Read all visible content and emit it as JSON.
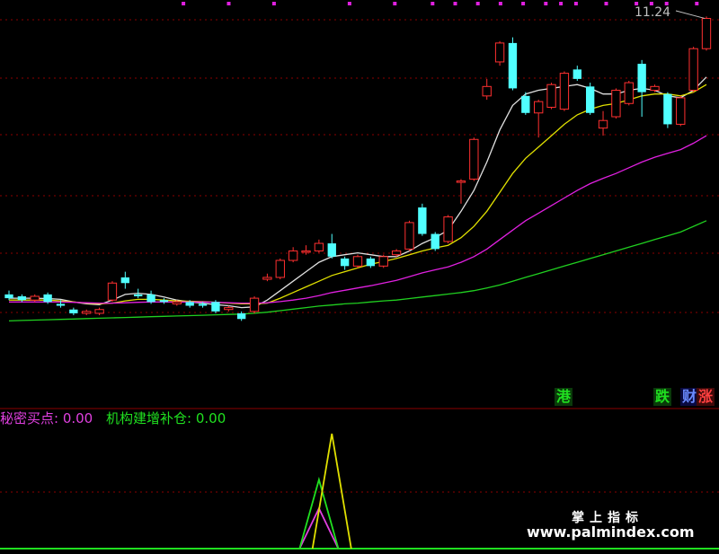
{
  "chart_data": {
    "type": "candlestick",
    "price_label": "11.24",
    "upper_price_range": [
      2.0,
      11.5
    ],
    "candles": [
      {
        "o": 3.95,
        "c": 3.85,
        "h": 4.05,
        "l": 3.8,
        "up": false
      },
      {
        "o": 3.9,
        "c": 3.8,
        "h": 3.95,
        "l": 3.75,
        "up": false
      },
      {
        "o": 3.8,
        "c": 3.9,
        "h": 3.95,
        "l": 3.75,
        "up": true
      },
      {
        "o": 3.95,
        "c": 3.75,
        "h": 4.0,
        "l": 3.7,
        "up": false
      },
      {
        "o": 3.7,
        "c": 3.65,
        "h": 3.8,
        "l": 3.6,
        "up": false
      },
      {
        "o": 3.55,
        "c": 3.45,
        "h": 3.6,
        "l": 3.4,
        "up": false
      },
      {
        "o": 3.45,
        "c": 3.5,
        "h": 3.55,
        "l": 3.4,
        "up": true
      },
      {
        "o": 3.45,
        "c": 3.55,
        "h": 3.6,
        "l": 3.4,
        "up": true
      },
      {
        "o": 3.8,
        "c": 4.25,
        "h": 4.3,
        "l": 3.75,
        "up": true
      },
      {
        "o": 4.4,
        "c": 4.25,
        "h": 4.55,
        "l": 4.1,
        "up": false
      },
      {
        "o": 3.95,
        "c": 3.9,
        "h": 4.1,
        "l": 3.85,
        "up": false
      },
      {
        "o": 3.95,
        "c": 3.75,
        "h": 4.05,
        "l": 3.7,
        "up": false
      },
      {
        "o": 3.8,
        "c": 3.75,
        "h": 3.85,
        "l": 3.7,
        "up": false
      },
      {
        "o": 3.7,
        "c": 3.75,
        "h": 3.8,
        "l": 3.65,
        "up": true
      },
      {
        "o": 3.75,
        "c": 3.65,
        "h": 3.8,
        "l": 3.6,
        "up": false
      },
      {
        "o": 3.7,
        "c": 3.65,
        "h": 3.75,
        "l": 3.6,
        "up": false
      },
      {
        "o": 3.75,
        "c": 3.5,
        "h": 3.8,
        "l": 3.45,
        "up": false
      },
      {
        "o": 3.55,
        "c": 3.6,
        "h": 3.65,
        "l": 3.5,
        "up": true
      },
      {
        "o": 3.45,
        "c": 3.3,
        "h": 3.5,
        "l": 3.25,
        "up": false
      },
      {
        "o": 3.5,
        "c": 3.85,
        "h": 3.9,
        "l": 3.45,
        "up": true
      },
      {
        "o": 4.35,
        "c": 4.4,
        "h": 4.5,
        "l": 4.3,
        "up": true
      },
      {
        "o": 4.4,
        "c": 4.85,
        "h": 4.9,
        "l": 4.35,
        "up": true
      },
      {
        "o": 4.85,
        "c": 5.1,
        "h": 5.2,
        "l": 4.8,
        "up": true
      },
      {
        "o": 5.1,
        "c": 5.1,
        "h": 5.25,
        "l": 5.0,
        "up": true
      },
      {
        "o": 5.1,
        "c": 5.3,
        "h": 5.4,
        "l": 5.05,
        "up": true
      },
      {
        "o": 5.3,
        "c": 4.95,
        "h": 5.55,
        "l": 4.9,
        "up": false
      },
      {
        "o": 4.9,
        "c": 4.7,
        "h": 4.95,
        "l": 4.6,
        "up": false
      },
      {
        "o": 4.7,
        "c": 4.95,
        "h": 5.0,
        "l": 4.65,
        "up": true
      },
      {
        "o": 4.9,
        "c": 4.7,
        "h": 4.95,
        "l": 4.65,
        "up": false
      },
      {
        "o": 4.7,
        "c": 4.95,
        "h": 5.0,
        "l": 4.65,
        "up": true
      },
      {
        "o": 5.0,
        "c": 5.1,
        "h": 5.15,
        "l": 4.95,
        "up": true
      },
      {
        "o": 5.15,
        "c": 5.85,
        "h": 5.9,
        "l": 5.1,
        "up": true
      },
      {
        "o": 6.25,
        "c": 5.55,
        "h": 6.35,
        "l": 5.5,
        "up": false
      },
      {
        "o": 5.55,
        "c": 5.15,
        "h": 5.6,
        "l": 5.1,
        "up": false
      },
      {
        "o": 5.35,
        "c": 6.0,
        "h": 6.05,
        "l": 5.3,
        "up": true
      },
      {
        "o": 6.95,
        "c": 6.95,
        "h": 7.0,
        "l": 6.35,
        "up": true
      },
      {
        "o": 7.0,
        "c": 8.05,
        "h": 8.1,
        "l": 6.95,
        "up": true
      },
      {
        "o": 9.2,
        "c": 9.45,
        "h": 9.65,
        "l": 9.1,
        "up": true
      },
      {
        "o": 10.1,
        "c": 10.6,
        "h": 10.65,
        "l": 10.0,
        "up": true
      },
      {
        "o": 10.6,
        "c": 9.4,
        "h": 10.75,
        "l": 9.35,
        "up": false
      },
      {
        "o": 9.2,
        "c": 8.75,
        "h": 9.3,
        "l": 8.7,
        "up": false
      },
      {
        "o": 8.75,
        "c": 9.05,
        "h": 9.1,
        "l": 8.1,
        "up": true
      },
      {
        "o": 8.9,
        "c": 9.5,
        "h": 9.55,
        "l": 8.85,
        "up": true
      },
      {
        "o": 8.85,
        "c": 9.8,
        "h": 9.85,
        "l": 8.8,
        "up": true
      },
      {
        "o": 9.9,
        "c": 9.65,
        "h": 10.0,
        "l": 9.6,
        "up": false
      },
      {
        "o": 9.45,
        "c": 8.75,
        "h": 9.55,
        "l": 8.7,
        "up": false
      },
      {
        "o": 8.35,
        "c": 8.55,
        "h": 8.8,
        "l": 8.15,
        "up": true
      },
      {
        "o": 8.65,
        "c": 9.35,
        "h": 9.4,
        "l": 8.6,
        "up": true
      },
      {
        "o": 9.0,
        "c": 9.55,
        "h": 9.6,
        "l": 8.95,
        "up": true
      },
      {
        "o": 10.05,
        "c": 9.3,
        "h": 10.15,
        "l": 8.65,
        "up": false
      },
      {
        "o": 9.35,
        "c": 9.45,
        "h": 9.5,
        "l": 9.3,
        "up": true
      },
      {
        "o": 9.25,
        "c": 8.45,
        "h": 9.3,
        "l": 8.35,
        "up": false
      },
      {
        "o": 8.45,
        "c": 9.15,
        "h": 9.2,
        "l": 8.4,
        "up": true
      },
      {
        "o": 9.35,
        "c": 10.45,
        "h": 10.5,
        "l": 9.3,
        "up": true
      },
      {
        "o": 10.45,
        "c": 11.25,
        "h": 11.3,
        "l": 10.4,
        "up": true
      }
    ],
    "ma_lines": [
      {
        "color": "#e0e0e0",
        "values": [
          3.85,
          3.85,
          3.85,
          3.84,
          3.82,
          3.75,
          3.7,
          3.68,
          3.8,
          3.95,
          3.98,
          3.95,
          3.88,
          3.8,
          3.75,
          3.72,
          3.68,
          3.65,
          3.6,
          3.62,
          3.8,
          4.05,
          4.3,
          4.55,
          4.8,
          4.95,
          5.0,
          5.05,
          5.0,
          4.95,
          4.95,
          5.1,
          5.3,
          5.45,
          5.65,
          6.15,
          6.7,
          7.45,
          8.3,
          8.95,
          9.25,
          9.35,
          9.4,
          9.45,
          9.5,
          9.4,
          9.25,
          9.25,
          9.35,
          9.4,
          9.35,
          9.2,
          9.15,
          9.35,
          9.7
        ]
      },
      {
        "color": "#e0e000",
        "values": [
          3.8,
          3.8,
          3.8,
          3.8,
          3.78,
          3.75,
          3.72,
          3.7,
          3.72,
          3.78,
          3.82,
          3.82,
          3.8,
          3.78,
          3.77,
          3.76,
          3.74,
          3.72,
          3.7,
          3.7,
          3.72,
          3.85,
          4.0,
          4.15,
          4.3,
          4.45,
          4.55,
          4.65,
          4.75,
          4.82,
          4.9,
          5.0,
          5.1,
          5.18,
          5.25,
          5.45,
          5.75,
          6.15,
          6.65,
          7.15,
          7.55,
          7.85,
          8.15,
          8.45,
          8.7,
          8.85,
          8.95,
          9.0,
          9.1,
          9.2,
          9.25,
          9.25,
          9.2,
          9.3,
          9.5
        ]
      },
      {
        "color": "#e020e0",
        "values": [
          3.75,
          3.75,
          3.75,
          3.75,
          3.75,
          3.74,
          3.73,
          3.72,
          3.72,
          3.73,
          3.74,
          3.75,
          3.75,
          3.75,
          3.75,
          3.75,
          3.74,
          3.73,
          3.72,
          3.72,
          3.73,
          3.76,
          3.8,
          3.85,
          3.92,
          4.0,
          4.06,
          4.12,
          4.18,
          4.25,
          4.32,
          4.42,
          4.52,
          4.6,
          4.68,
          4.8,
          4.95,
          5.15,
          5.4,
          5.65,
          5.9,
          6.1,
          6.3,
          6.5,
          6.7,
          6.88,
          7.02,
          7.15,
          7.3,
          7.45,
          7.58,
          7.68,
          7.78,
          7.95,
          8.15
        ]
      },
      {
        "color": "#20d020",
        "values": [
          3.25,
          3.26,
          3.27,
          3.28,
          3.29,
          3.3,
          3.31,
          3.32,
          3.33,
          3.34,
          3.35,
          3.36,
          3.37,
          3.38,
          3.39,
          3.4,
          3.41,
          3.42,
          3.43,
          3.45,
          3.48,
          3.52,
          3.56,
          3.6,
          3.64,
          3.67,
          3.7,
          3.72,
          3.75,
          3.78,
          3.8,
          3.84,
          3.88,
          3.92,
          3.96,
          4.0,
          4.05,
          4.12,
          4.2,
          4.3,
          4.4,
          4.5,
          4.6,
          4.7,
          4.8,
          4.9,
          5.0,
          5.1,
          5.2,
          5.3,
          5.4,
          5.5,
          5.6,
          5.75,
          5.9
        ]
      }
    ],
    "indicator": {
      "lines": [
        {
          "name": "秘密买点",
          "color": "#e040e0",
          "value_label": "0.00",
          "spike_at": 24,
          "spike_height": 0.35
        },
        {
          "name": "机构建增补仓",
          "color": "#20e020",
          "value_label": "0.00",
          "spike_at": 24,
          "spike_height": 0.6
        },
        {
          "name": "",
          "color": "#e0e000",
          "spike_at": 25,
          "spike_height": 1.0
        }
      ],
      "range": [
        0,
        1
      ]
    },
    "top_markers": [
      24,
      30,
      36,
      46,
      52,
      57,
      60,
      63,
      66,
      69,
      72,
      74,
      76,
      80,
      84,
      86,
      88,
      92
    ]
  },
  "legend": {
    "line1": "秘密买点: 0.00",
    "line2": "机构建增补仓: 0.00"
  },
  "tags": {
    "t1": "港",
    "t2": "跌",
    "t3": "财",
    "t4": "涨"
  },
  "watermark": {
    "line1": "掌上指标",
    "line2": "www.palmindex.com"
  },
  "colors": {
    "up": "#ff3030",
    "down": "#50ffff",
    "grid": "#8b0000"
  }
}
